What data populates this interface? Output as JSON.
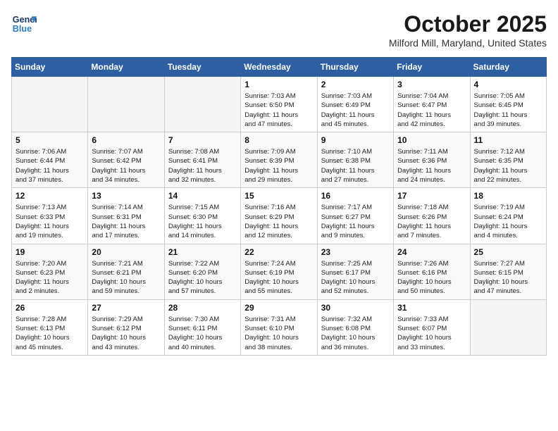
{
  "header": {
    "logo_line1": "General",
    "logo_line2": "Blue",
    "month_title": "October 2025",
    "location": "Milford Mill, Maryland, United States"
  },
  "weekdays": [
    "Sunday",
    "Monday",
    "Tuesday",
    "Wednesday",
    "Thursday",
    "Friday",
    "Saturday"
  ],
  "weeks": [
    [
      {
        "day": "",
        "info": ""
      },
      {
        "day": "",
        "info": ""
      },
      {
        "day": "",
        "info": ""
      },
      {
        "day": "1",
        "info": "Sunrise: 7:03 AM\nSunset: 6:50 PM\nDaylight: 11 hours\nand 47 minutes."
      },
      {
        "day": "2",
        "info": "Sunrise: 7:03 AM\nSunset: 6:49 PM\nDaylight: 11 hours\nand 45 minutes."
      },
      {
        "day": "3",
        "info": "Sunrise: 7:04 AM\nSunset: 6:47 PM\nDaylight: 11 hours\nand 42 minutes."
      },
      {
        "day": "4",
        "info": "Sunrise: 7:05 AM\nSunset: 6:45 PM\nDaylight: 11 hours\nand 39 minutes."
      }
    ],
    [
      {
        "day": "5",
        "info": "Sunrise: 7:06 AM\nSunset: 6:44 PM\nDaylight: 11 hours\nand 37 minutes."
      },
      {
        "day": "6",
        "info": "Sunrise: 7:07 AM\nSunset: 6:42 PM\nDaylight: 11 hours\nand 34 minutes."
      },
      {
        "day": "7",
        "info": "Sunrise: 7:08 AM\nSunset: 6:41 PM\nDaylight: 11 hours\nand 32 minutes."
      },
      {
        "day": "8",
        "info": "Sunrise: 7:09 AM\nSunset: 6:39 PM\nDaylight: 11 hours\nand 29 minutes."
      },
      {
        "day": "9",
        "info": "Sunrise: 7:10 AM\nSunset: 6:38 PM\nDaylight: 11 hours\nand 27 minutes."
      },
      {
        "day": "10",
        "info": "Sunrise: 7:11 AM\nSunset: 6:36 PM\nDaylight: 11 hours\nand 24 minutes."
      },
      {
        "day": "11",
        "info": "Sunrise: 7:12 AM\nSunset: 6:35 PM\nDaylight: 11 hours\nand 22 minutes."
      }
    ],
    [
      {
        "day": "12",
        "info": "Sunrise: 7:13 AM\nSunset: 6:33 PM\nDaylight: 11 hours\nand 19 minutes."
      },
      {
        "day": "13",
        "info": "Sunrise: 7:14 AM\nSunset: 6:31 PM\nDaylight: 11 hours\nand 17 minutes."
      },
      {
        "day": "14",
        "info": "Sunrise: 7:15 AM\nSunset: 6:30 PM\nDaylight: 11 hours\nand 14 minutes."
      },
      {
        "day": "15",
        "info": "Sunrise: 7:16 AM\nSunset: 6:29 PM\nDaylight: 11 hours\nand 12 minutes."
      },
      {
        "day": "16",
        "info": "Sunrise: 7:17 AM\nSunset: 6:27 PM\nDaylight: 11 hours\nand 9 minutes."
      },
      {
        "day": "17",
        "info": "Sunrise: 7:18 AM\nSunset: 6:26 PM\nDaylight: 11 hours\nand 7 minutes."
      },
      {
        "day": "18",
        "info": "Sunrise: 7:19 AM\nSunset: 6:24 PM\nDaylight: 11 hours\nand 4 minutes."
      }
    ],
    [
      {
        "day": "19",
        "info": "Sunrise: 7:20 AM\nSunset: 6:23 PM\nDaylight: 11 hours\nand 2 minutes."
      },
      {
        "day": "20",
        "info": "Sunrise: 7:21 AM\nSunset: 6:21 PM\nDaylight: 10 hours\nand 59 minutes."
      },
      {
        "day": "21",
        "info": "Sunrise: 7:22 AM\nSunset: 6:20 PM\nDaylight: 10 hours\nand 57 minutes."
      },
      {
        "day": "22",
        "info": "Sunrise: 7:24 AM\nSunset: 6:19 PM\nDaylight: 10 hours\nand 55 minutes."
      },
      {
        "day": "23",
        "info": "Sunrise: 7:25 AM\nSunset: 6:17 PM\nDaylight: 10 hours\nand 52 minutes."
      },
      {
        "day": "24",
        "info": "Sunrise: 7:26 AM\nSunset: 6:16 PM\nDaylight: 10 hours\nand 50 minutes."
      },
      {
        "day": "25",
        "info": "Sunrise: 7:27 AM\nSunset: 6:15 PM\nDaylight: 10 hours\nand 47 minutes."
      }
    ],
    [
      {
        "day": "26",
        "info": "Sunrise: 7:28 AM\nSunset: 6:13 PM\nDaylight: 10 hours\nand 45 minutes."
      },
      {
        "day": "27",
        "info": "Sunrise: 7:29 AM\nSunset: 6:12 PM\nDaylight: 10 hours\nand 43 minutes."
      },
      {
        "day": "28",
        "info": "Sunrise: 7:30 AM\nSunset: 6:11 PM\nDaylight: 10 hours\nand 40 minutes."
      },
      {
        "day": "29",
        "info": "Sunrise: 7:31 AM\nSunset: 6:10 PM\nDaylight: 10 hours\nand 38 minutes."
      },
      {
        "day": "30",
        "info": "Sunrise: 7:32 AM\nSunset: 6:08 PM\nDaylight: 10 hours\nand 36 minutes."
      },
      {
        "day": "31",
        "info": "Sunrise: 7:33 AM\nSunset: 6:07 PM\nDaylight: 10 hours\nand 33 minutes."
      },
      {
        "day": "",
        "info": ""
      }
    ]
  ]
}
